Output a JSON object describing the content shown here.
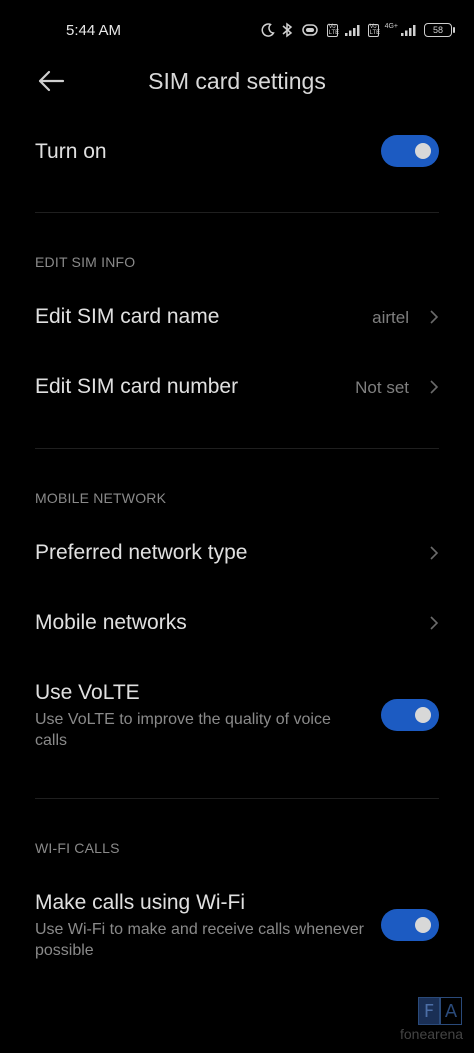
{
  "status_bar": {
    "time": "5:44 AM",
    "network_4g_label": "4G+",
    "volte_badge_1": "Vo LTE",
    "volte_badge_2": "Vo LTE",
    "battery_level": "58"
  },
  "header": {
    "title": "SIM card settings"
  },
  "turn_on": {
    "label": "Turn on",
    "enabled": true
  },
  "edit_sim_info": {
    "section_label": "EDIT SIM INFO",
    "name_row": {
      "label": "Edit SIM card name",
      "value": "airtel"
    },
    "number_row": {
      "label": "Edit SIM card number",
      "value": "Not set"
    }
  },
  "mobile_network": {
    "section_label": "MOBILE NETWORK",
    "preferred_network": {
      "label": "Preferred network type"
    },
    "mobile_networks": {
      "label": "Mobile networks"
    },
    "volte": {
      "label": "Use VoLTE",
      "description": "Use VoLTE to improve the quality of voice calls",
      "enabled": true
    }
  },
  "wifi_calls": {
    "section_label": "WI-FI CALLS",
    "wifi_calling": {
      "label": "Make calls using Wi-Fi",
      "description": "Use Wi-Fi to make and receive calls whenever possible",
      "enabled": true
    }
  },
  "watermark": {
    "letter_1": "F",
    "letter_2": "A",
    "text": "fonearena"
  },
  "colors": {
    "background": "#000000",
    "toggle_on": "#1c5bc2",
    "primary_text": "#e0e0e0",
    "secondary_text": "#8a8a8a"
  }
}
